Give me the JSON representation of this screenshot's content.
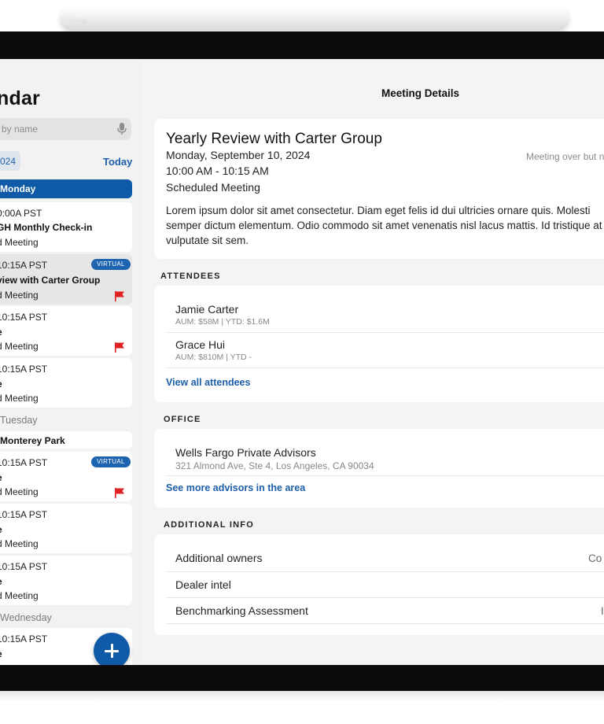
{
  "calendar": {
    "title": "ndar",
    "search_placeholder": "by name",
    "date_chip": "024",
    "today_label": "Today",
    "days": [
      {
        "label": "Monday"
      },
      {
        "label": "Tuesday"
      },
      {
        "label": "Wednesday"
      }
    ],
    "cards": [
      {
        "time": "0:00A PST",
        "title": "GH Monthly Check-in",
        "type": "d Meeting",
        "virtual": false,
        "flag": false
      },
      {
        "time": "10:15A PST",
        "title": "view with Carter Group",
        "type": "d Meeting",
        "virtual": true,
        "flag": true
      },
      {
        "time": "10:15A PST",
        "title": "e",
        "type": "d Meeting",
        "virtual": false,
        "flag": true
      },
      {
        "time": "10:15A PST",
        "title": "e",
        "type": "d Meeting",
        "virtual": false,
        "flag": false
      },
      {
        "header": "Monterey Park"
      },
      {
        "time": "10:15A PST",
        "title": "e",
        "type": "d Meeting",
        "virtual": true,
        "flag": true
      },
      {
        "time": "10:15A PST",
        "title": "e",
        "type": "d Meeting",
        "virtual": false,
        "flag": false
      },
      {
        "time": "10:15A PST",
        "title": "e",
        "type": "d Meeting",
        "virtual": false,
        "flag": false
      },
      {
        "time": "10:15A PST",
        "title": "e"
      }
    ],
    "virtual_badge": "VIRTUAL"
  },
  "details": {
    "header": "Meeting Details",
    "title": "Yearly Review with Carter Group",
    "date": "Monday, September 10, 2024",
    "time": "10:00 AM - 10:15 AM",
    "type": "Scheduled Meeting",
    "status": "Meeting over but n",
    "body": "Lorem ipsum dolor sit amet consectetur. Diam eget felis id dui ultricies ornare quis. Molesti semper dictum elementum. Odio commodo sit amet venenatis nisl lacus mattis. Id tristique at elit vulputate sit sem."
  },
  "attendees": {
    "heading": "ATTENDEES",
    "items": [
      {
        "name": "Jamie Carter",
        "sub": "AUM: $58M | YTD: $1.6M"
      },
      {
        "name": "Grace Hui",
        "sub": "AUM: $810M | YTD -"
      }
    ],
    "link": "View all attendees"
  },
  "office": {
    "heading": "OFFICE",
    "name": "Wells Fargo Private Advisors",
    "address": "321 Almond Ave, Ste 4, Los Angeles, CA 90034",
    "link": "See more advisors in the area"
  },
  "additional": {
    "heading": "ADDITIONAL INFO",
    "rows": [
      {
        "label": "Additional owners",
        "value": "Co"
      },
      {
        "label": "Dealer intel",
        "value": ""
      },
      {
        "label": "Benchmarking Assessment",
        "value": "I"
      }
    ]
  },
  "colors": {
    "accent": "#0f5aa6",
    "link": "#1d5fa8",
    "flag": "#e02020"
  }
}
